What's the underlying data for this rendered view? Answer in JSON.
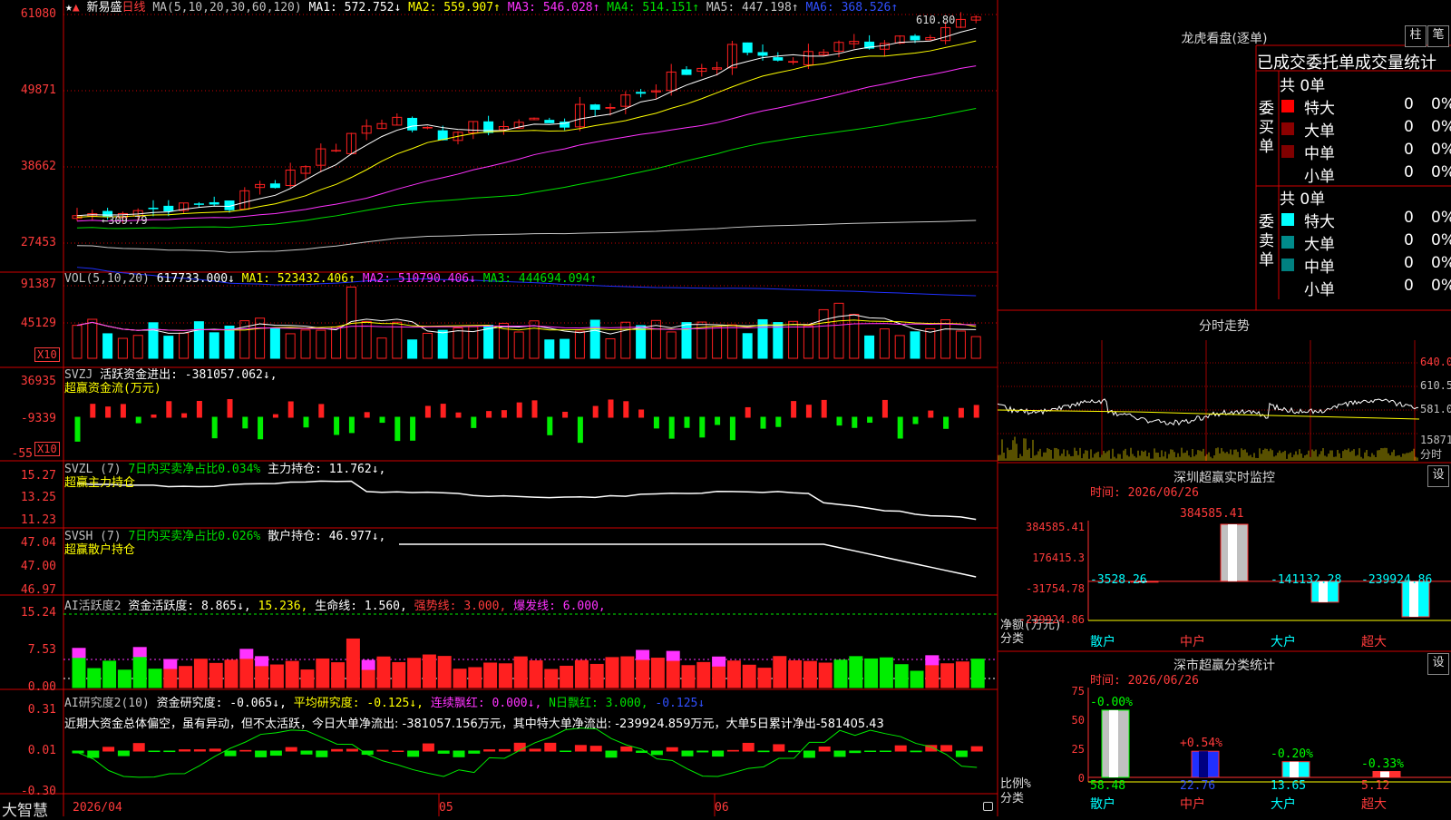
{
  "colors": {
    "up": "#ff2020",
    "down": "#00ffff",
    "grid": "#d00000",
    "ma1": "#ffffff",
    "ma2": "#ffff00",
    "ma3": "#ff33ff",
    "ma4": "#00e000",
    "ma5": "#c8c8c8",
    "ma6": "#2030ff",
    "buy": "#ff0000",
    "green": "#00ee00",
    "magenta": "#ff33ff"
  },
  "main": {
    "title": "新易盛",
    "period": "日线",
    "ma_params": "MA(5,10,20,30,60,120)",
    "ma1": "MA1: 572.752↓",
    "ma2": "MA2: 559.907↑",
    "ma3": "MA3: 546.028↑",
    "ma4": "MA4: 514.151↑",
    "ma5": "MA5: 447.198↑",
    "ma6": "MA6: 368.526↑",
    "y_labels": [
      "61080",
      "49871",
      "38662",
      "27453"
    ],
    "high_label": "610.80",
    "low_label": "309.79"
  },
  "vol": {
    "label": "VOL(5,10,20)",
    "value": "617733.000↓",
    "ma1": "MA1: 523432.406↑",
    "ma2": "MA2: 510790.406↓",
    "ma3": "MA3: 444694.094↑",
    "y_labels": [
      "91387",
      "45129"
    ],
    "unit": "X10"
  },
  "svzj": {
    "label": "SVZJ",
    "text": "活跃资金进出: -381057.062↓,",
    "sub": "超赢资金流(万元)",
    "y_labels": [
      "36935",
      "-9339",
      "-55"
    ],
    "unit": "X10"
  },
  "svzl": {
    "label": "SVZL (7)",
    "p1": "7日内买卖净占比0.034%",
    "p2": "主力持仓: 11.762↓,",
    "sub": "超赢主力持仓",
    "y_labels": [
      "15.27",
      "13.25",
      "11.23"
    ]
  },
  "svsh": {
    "label": "SVSH (7)",
    "p1": "7日内买卖净占比0.026%",
    "p2": "散户持仓: 46.977↓,",
    "sub": "超赢散户持仓",
    "y_labels": [
      "47.04",
      "47.00",
      "46.97"
    ]
  },
  "ai1": {
    "label": "AI活跃度2",
    "p1": "资金活跃度: 8.865↓,",
    "p2": "15.236,",
    "p3": "生命线: 1.560,",
    "p4": "强势线: 3.000,",
    "p5": "爆发线: 6.000,",
    "y_labels": [
      "15.24",
      "7.53",
      "0.00"
    ]
  },
  "ai2": {
    "label": "AI研究度2(10)",
    "p1": "资金研究度: -0.065↓,",
    "p2": "平均研究度: -0.125↓,",
    "p3": "连续飘红: 0.000↓,",
    "p4": "N日飘红: 3.000,",
    "p5": "-0.125↓",
    "note": "近期大资金总体偏空，虽有异动，但不太活跃，今日大单净流出: -381057.156万元，其中特大单净流出: -239924.859万元，大单5日累计净出-581405.43",
    "y_labels": [
      "0.31",
      "0.01",
      "-0.30"
    ]
  },
  "xaxis": {
    "labels": [
      "2026/04",
      "05",
      "06"
    ]
  },
  "footer": {
    "brand": "大智慧"
  },
  "lh": {
    "title": "龙虎看盘(逐单)",
    "btn1": "柱",
    "btn2": "笔",
    "header": "已成交委托单成交量统计",
    "buy_side": "委买单",
    "sell_side": "委卖单",
    "buy_count": "共 0单",
    "sell_count": "共 0单",
    "buy_rows": [
      {
        "label": "特大",
        "v": "0",
        "p": "0%"
      },
      {
        "label": "大单",
        "v": "0",
        "p": "0%"
      },
      {
        "label": "中单",
        "v": "0",
        "p": "0%"
      },
      {
        "label": "小单",
        "v": "0",
        "p": "0%"
      }
    ],
    "sell_rows": [
      {
        "label": "特大",
        "v": "0",
        "p": "0%"
      },
      {
        "label": "大单",
        "v": "0",
        "p": "0%"
      },
      {
        "label": "中单",
        "v": "0",
        "p": "0%"
      },
      {
        "label": "小单",
        "v": "0",
        "p": "0%"
      }
    ]
  },
  "intraday": {
    "title": "分时走势",
    "y_labels": [
      "640.0",
      "610.5",
      "581.0",
      "15871",
      "分时"
    ]
  },
  "sz_monitor": {
    "title": "深圳超赢实时监控",
    "btn": "设",
    "time": "时间: 2026/06/26",
    "y_labels": [
      "384585.41",
      "176415.3",
      "-31754.78",
      "-239924.86"
    ],
    "ylabel": "净额(万元)",
    "xlabel": "分类",
    "categories": [
      "散户",
      "中户",
      "大户",
      "超大"
    ],
    "values": [
      -3528.26,
      384585.41,
      -141132.28,
      -239924.86
    ],
    "value_labels": [
      "-3528.26",
      "384585.41",
      "-141132.28",
      "-239924.86"
    ]
  },
  "sz_class": {
    "title": "深市超赢分类统计",
    "btn": "设",
    "time": "时间: 2026/06/26",
    "y_labels": [
      "75",
      "50",
      "25",
      "0"
    ],
    "ylabel": "比例%",
    "xlabel": "分类",
    "categories": [
      "散户",
      "中户",
      "大户",
      "超大"
    ],
    "values": [
      58.48,
      22.76,
      13.65,
      5.12
    ],
    "value_labels": [
      "58.48",
      "22.76",
      "13.65",
      "5.12"
    ],
    "changes": [
      "-0.00%",
      "+0.54%",
      "-0.20%",
      "-0.33%"
    ]
  }
}
